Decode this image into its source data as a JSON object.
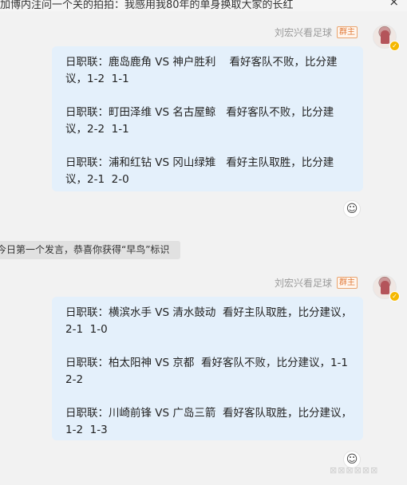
{
  "top_banner": {
    "text": "加博内注问一个关的拍拍：我感用我80年的单身换取大家的长红",
    "close_label": "×"
  },
  "messages": [
    {
      "sender": "刘宏兴看足球",
      "badge": "群主",
      "paragraphs": [
        "日职联：鹿岛鹿角 VS 神户胜利    看好客队不败，比分建议，1-2  1-1",
        "日职联：町田泽维 VS 名古屋鲸   看好客队不败，比分建议，2-2  1-1",
        "日职联：浦和红钻 VS 冈山绿雉   看好主队取胜，比分建议，2-1  2-0"
      ]
    },
    {
      "sender": "刘宏兴看足球",
      "badge": "群主",
      "paragraphs": [
        "日职联：横滨水手 VS 清水鼓动  看好主队取胜，比分建议，2-1  1-0",
        "日职联：柏太阳神 VS 京都  看好客队不败，比分建议，1-1  2-2",
        "日职联：川崎前锋 VS 广岛三箭  看好客队取胜，比分建议，1-2  1-3"
      ]
    }
  ],
  "system_notice": "今日第一个发言，恭喜你获得“早鸟”标识",
  "reaction_icon": "smiley-plus-icon",
  "verified_icon": "verified-badge-icon",
  "watermark": "⊠⊠⊠⊠⊠⊠"
}
